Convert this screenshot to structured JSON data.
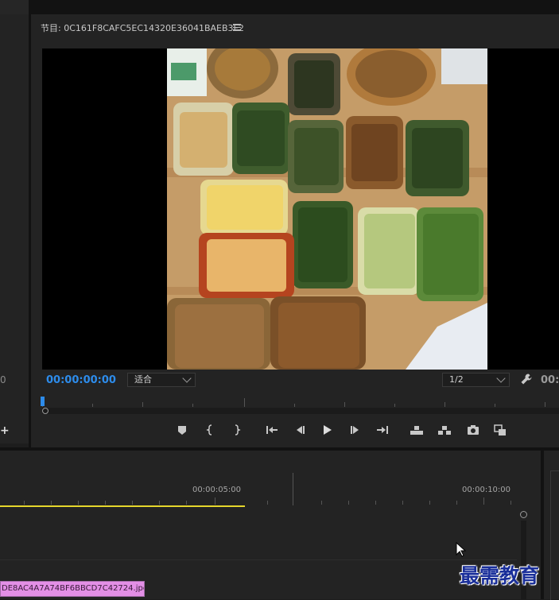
{
  "program_monitor": {
    "title": "节目: 0C161F8CAFC5EC14320E36041BAEB3F2",
    "menu_icon": "hamburger-icon",
    "timecode": "00:00:00:00",
    "fit_label": "适合",
    "resolution_label": "1/2",
    "right_timecode_partial": "00:",
    "wrench_icon": "wrench-icon",
    "controls": [
      "marker-icon",
      "mark-in-icon",
      "mark-out-icon",
      "go-to-in-icon",
      "step-back-icon",
      "play-icon",
      "step-forward-icon",
      "go-to-out-icon",
      "lift-icon",
      "extract-icon",
      "camera-icon",
      "compare-icon"
    ]
  },
  "left_panel": {
    "partial_number": "0",
    "add_label": "+"
  },
  "timeline": {
    "time_label_1": "00:00:05:00",
    "time_label_2": "00:00:10:00",
    "clip_name": "DE8AC4A7A74BF6BBCD7C42724.jpg",
    "clip_color": "#e38fe6",
    "work_area_color": "#e6d72c"
  },
  "watermark": {
    "text": "最需教育"
  }
}
